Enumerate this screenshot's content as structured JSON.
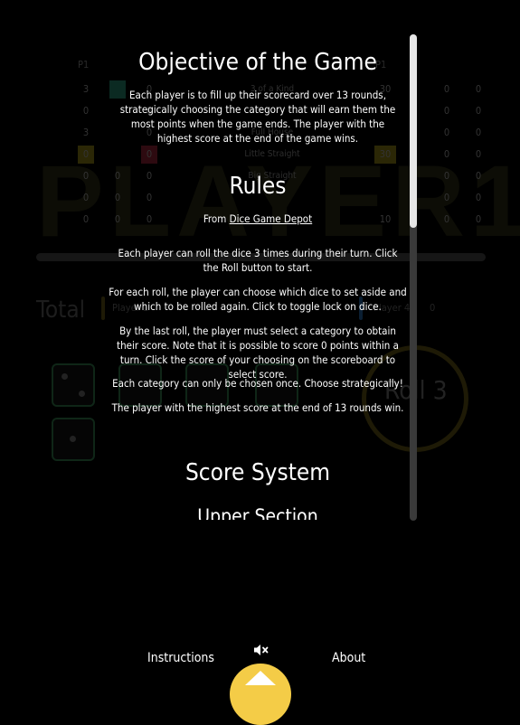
{
  "background": {
    "watermark": "PLAYER1",
    "p1_left": "P1",
    "p1_right": "P1",
    "categories": [
      "3 of a Kind",
      "",
      "Full House",
      "Little Straight",
      "Big Straight",
      "",
      ""
    ],
    "total_label": "Total",
    "player1_label": "Player 1",
    "player4_label": "Player 4",
    "player4_value": "0",
    "roll_label": "Roll 3",
    "rows": [
      [
        "3",
        "",
        "0",
        "",
        "",
        "",
        "0",
        "0"
      ],
      [
        "0",
        "",
        "0",
        "",
        "",
        "",
        "0",
        "0"
      ],
      [
        "3",
        "",
        "0",
        "",
        "",
        "",
        "0",
        "0"
      ],
      [
        "0",
        "",
        "0",
        "",
        "",
        "",
        "0",
        "0"
      ],
      [
        "0",
        "0",
        "0",
        "",
        "",
        "",
        "0",
        "0"
      ],
      [
        "0",
        "0",
        "0",
        "",
        "",
        "",
        "0",
        "0"
      ],
      [
        "0",
        "0",
        "0",
        "",
        "",
        "",
        "0",
        "0"
      ]
    ],
    "right_col": [
      "30",
      "",
      "",
      "30",
      "",
      "",
      "10"
    ],
    "colors": {
      "green": "#0b2a22",
      "red": "#2d0a10",
      "yellow": "#2b2706"
    }
  },
  "instructions": {
    "objective_title": "Objective of the Game",
    "objective_text": "Each player is to fill up their scorecard over 13 rounds, strategically choosing the category that will earn them the most points when the game ends. The player with the highest score at the end of the game wins.",
    "rules_title": "Rules",
    "from_prefix": "From ",
    "source_link": "Dice Game Depot",
    "rule_1": "Each player can roll the dice 3 times during their turn. Click the Roll button to start.",
    "rule_2": "For each roll, the player can choose which dice to set aside and which to be rolled again. Click to toggle lock on dice.",
    "rule_3": "By the last roll, the player must select a category to obtain their score. Note that it is possible to score 0 points within a turn. Click the score of your choosing on the scoreboard to select score.",
    "rule_4": "Each category can only be chosen once. Choose strategically!",
    "rule_5": "The player with the highest score at the end of 13 rounds win.",
    "score_title": "Score System",
    "upper_title": "Upper Section"
  },
  "nav": {
    "instructions_label": "Instructions",
    "about_label": "About",
    "mute_icon": "speaker-muted-icon",
    "fab_icon": "chevron-up-icon",
    "fab_color": "#f4cc47"
  }
}
